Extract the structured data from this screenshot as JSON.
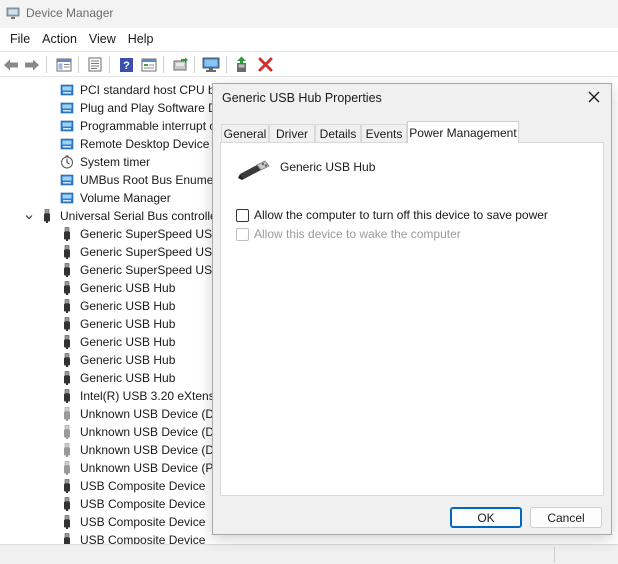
{
  "window": {
    "title": "Device Manager"
  },
  "menu": [
    "File",
    "Action",
    "View",
    "Help"
  ],
  "toolbar": {
    "icons": [
      "back-arrow-icon",
      "forward-arrow-icon",
      "show-hide-tree-icon",
      "properties-sheet-icon",
      "help-icon",
      "device-view-icon",
      "update-driver-icon",
      "monitor-icon",
      "add-driver-icon",
      "uninstall-icon"
    ]
  },
  "tree": {
    "rows": [
      {
        "label": "PCI standard host CPU br",
        "icon": "system-device-icon",
        "indent": 1
      },
      {
        "label": "Plug and Play Software D",
        "icon": "system-device-icon",
        "indent": 1
      },
      {
        "label": "Programmable interrupt c",
        "icon": "system-device-icon",
        "indent": 1
      },
      {
        "label": "Remote Desktop Device R",
        "icon": "system-device-icon",
        "indent": 1
      },
      {
        "label": "System timer",
        "icon": "timer-icon",
        "indent": 1
      },
      {
        "label": "UMBus Root Bus Enumer",
        "icon": "system-device-icon",
        "indent": 1
      },
      {
        "label": "Volume Manager",
        "icon": "system-device-icon",
        "indent": 1
      },
      {
        "label": "Universal Serial Bus controlle",
        "icon": "usb-plug-icon",
        "indent": 0,
        "expanded": true
      },
      {
        "label": "Generic SuperSpeed USB",
        "icon": "usb-plug-icon",
        "indent": 1
      },
      {
        "label": "Generic SuperSpeed USB",
        "icon": "usb-plug-icon",
        "indent": 1
      },
      {
        "label": "Generic SuperSpeed USB",
        "icon": "usb-plug-icon",
        "indent": 1
      },
      {
        "label": "Generic USB Hub",
        "icon": "usb-plug-icon",
        "indent": 1
      },
      {
        "label": "Generic USB Hub",
        "icon": "usb-plug-icon",
        "indent": 1
      },
      {
        "label": "Generic USB Hub",
        "icon": "usb-plug-icon",
        "indent": 1
      },
      {
        "label": "Generic USB Hub",
        "icon": "usb-plug-icon",
        "indent": 1
      },
      {
        "label": "Generic USB Hub",
        "icon": "usb-plug-icon",
        "indent": 1
      },
      {
        "label": "Generic USB Hub",
        "icon": "usb-plug-icon",
        "indent": 1
      },
      {
        "label": "Intel(R) USB 3.20 eXtensib",
        "icon": "usb-plug-icon",
        "indent": 1
      },
      {
        "label": "Unknown USB Device (De",
        "icon": "usb-plug-gray-icon",
        "indent": 1
      },
      {
        "label": "Unknown USB Device (De",
        "icon": "usb-plug-gray-icon",
        "indent": 1
      },
      {
        "label": "Unknown USB Device (De",
        "icon": "usb-plug-gray-icon",
        "indent": 1
      },
      {
        "label": "Unknown USB Device (Po",
        "icon": "usb-plug-gray-icon",
        "indent": 1
      },
      {
        "label": "USB Composite Device",
        "icon": "usb-plug-icon",
        "indent": 1
      },
      {
        "label": "USB Composite Device",
        "icon": "usb-plug-icon",
        "indent": 1
      },
      {
        "label": "USB Composite Device",
        "icon": "usb-plug-icon",
        "indent": 1
      },
      {
        "label": "USB Composite Device",
        "icon": "usb-plug-icon",
        "indent": 1
      }
    ]
  },
  "dialog": {
    "title": "Generic USB Hub Properties",
    "tabs": [
      "General",
      "Driver",
      "Details",
      "Events",
      "Power Management"
    ],
    "active_tab": "Power Management",
    "device_name": "Generic USB Hub",
    "options": [
      {
        "label": "Allow the computer to turn off this device to save power",
        "checked": false,
        "enabled": true
      },
      {
        "label": "Allow this device to wake the computer",
        "checked": false,
        "enabled": false
      }
    ],
    "ok_label": "OK",
    "cancel_label": "Cancel"
  },
  "colors": {
    "accent": "#0067c0",
    "system_device_blue": "#2b7fd0",
    "uninstall_red": "#d32f2f",
    "add_green": "#2e9b3a"
  }
}
